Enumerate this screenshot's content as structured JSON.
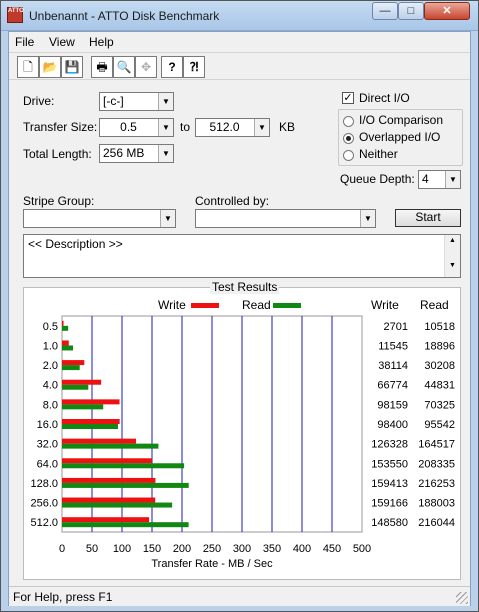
{
  "window": {
    "title": "Unbenannt - ATTO Disk Benchmark",
    "app_icon_text": "ATTO"
  },
  "titlebar_buttons": {
    "minimize": "—",
    "maximize": "□",
    "close": "✕"
  },
  "menu": [
    "File",
    "View",
    "Help"
  ],
  "toolbar": [
    {
      "name": "new-icon",
      "glyph": "🗋"
    },
    {
      "name": "open-icon",
      "glyph": "📂"
    },
    {
      "name": "save-icon",
      "glyph": "💾"
    },
    {
      "name": "print-icon",
      "glyph": "🖶"
    },
    {
      "name": "print-preview-icon",
      "glyph": "🔍"
    },
    {
      "name": "move-icon",
      "glyph": "✥"
    },
    {
      "name": "help-icon",
      "glyph": "?"
    },
    {
      "name": "context-help-icon",
      "glyph": "⁈"
    }
  ],
  "form": {
    "drive_label": "Drive:",
    "drive_value": "[-c-]",
    "transfer_size_label": "Transfer Size:",
    "transfer_from": "0.5",
    "to_label": "to",
    "transfer_to": "512.0",
    "kb_label": "KB",
    "total_length_label": "Total Length:",
    "total_length_value": "256 MB",
    "direct_io_label": "Direct I/O",
    "direct_io_checked": true,
    "io_options": [
      {
        "label": "I/O Comparison",
        "checked": false
      },
      {
        "label": "Overlapped I/O",
        "checked": true
      },
      {
        "label": "Neither",
        "checked": false
      }
    ],
    "queue_depth_label": "Queue Depth:",
    "queue_depth_value": "4",
    "stripe_group_label": "Stripe Group:",
    "controlled_by_label": "Controlled by:",
    "start_label": "Start",
    "description": "<< Description >>"
  },
  "chart_data": {
    "type": "bar",
    "orientation": "horizontal",
    "title": "Test Results",
    "xlabel": "Transfer Rate - MB / Sec",
    "xlim": [
      0,
      500
    ],
    "x_ticks": [
      "0",
      "50",
      "100",
      "150",
      "200",
      "250",
      "300",
      "350",
      "400",
      "450",
      "500"
    ],
    "categories": [
      "0.5",
      "1.0",
      "2.0",
      "4.0",
      "8.0",
      "16.0",
      "32.0",
      "64.0",
      "128.0",
      "256.0",
      "512.0"
    ],
    "series": [
      {
        "name": "Write",
        "color": "#ee1111",
        "values": [
          2.6,
          11.3,
          37.2,
          65.2,
          95.9,
          96.1,
          123.4,
          149.9,
          155.7,
          155.4,
          145.1
        ]
      },
      {
        "name": "Read",
        "color": "#118811",
        "values": [
          10.3,
          18.4,
          29.5,
          43.8,
          68.7,
          93.3,
          160.7,
          203.5,
          211.2,
          183.6,
          211.0
        ]
      }
    ],
    "table_headers": [
      "Write",
      "Read"
    ],
    "table_rows": [
      [
        "2701",
        "10518"
      ],
      [
        "11545",
        "18896"
      ],
      [
        "38114",
        "30208"
      ],
      [
        "66774",
        "44831"
      ],
      [
        "98159",
        "70325"
      ],
      [
        "98400",
        "95542"
      ],
      [
        "126328",
        "164517"
      ],
      [
        "153550",
        "208335"
      ],
      [
        "159413",
        "216253"
      ],
      [
        "159166",
        "188003"
      ],
      [
        "148580",
        "216044"
      ]
    ],
    "grid": true,
    "grid_color": "#1c1cb0"
  },
  "status": {
    "text": "For Help, press F1"
  }
}
